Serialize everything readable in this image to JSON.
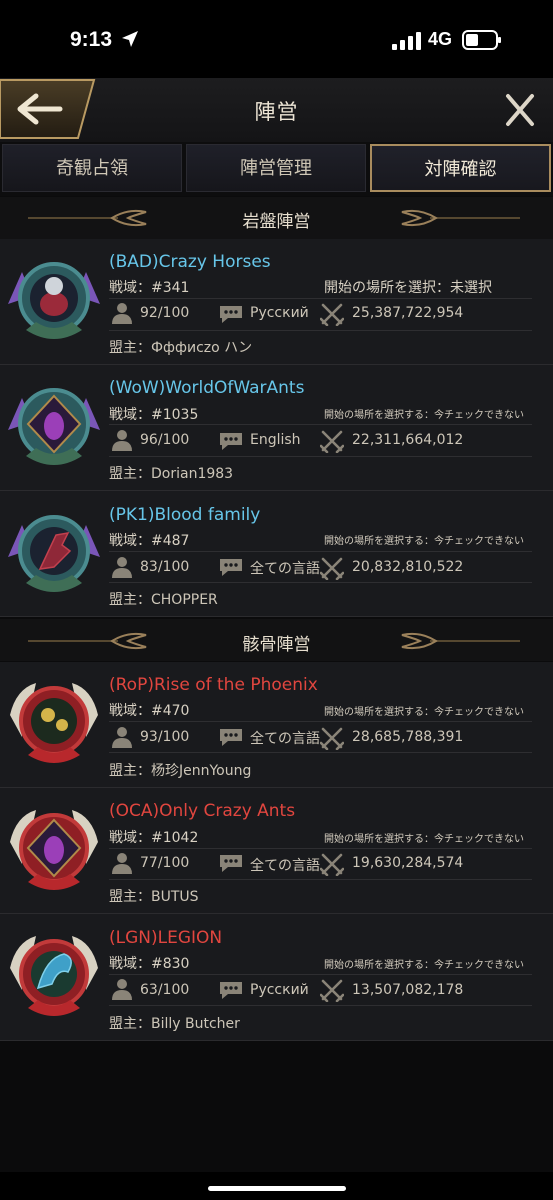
{
  "status": {
    "time": "9:13",
    "network": "4G"
  },
  "header": {
    "title": "陣営"
  },
  "tabs": [
    {
      "label": "奇観占領"
    },
    {
      "label": "陣営管理"
    },
    {
      "label": "対陣確認"
    }
  ],
  "sections": [
    {
      "title": "岩盤陣営",
      "alliances": [
        {
          "name": "(BAD)Crazy Horses",
          "zone": "戦域：#341",
          "start_label": "開始の場所を選択：未選択",
          "members": "92/100",
          "language": "Русский",
          "power": "25,387,722,954",
          "leader": "盟主：Ффф​исzо ハン"
        },
        {
          "name": "(WoW)WorldOfWarAnts",
          "zone": "戦域：#1035",
          "start_label": "開始の場所を選択する：今チェックできない",
          "members": "96/100",
          "language": "English",
          "power": "22,311,664,012",
          "leader": "盟主：Dorian1983"
        },
        {
          "name": "(PK1)Blood family",
          "zone": "戦域：#487",
          "start_label": "開始の場所を選択する：今チェックできない",
          "members": "83/100",
          "language": "全ての言語",
          "power": "20,832,810,522",
          "leader": "盟主：CHOPPER"
        }
      ]
    },
    {
      "title": "骸骨陣営",
      "alliances": [
        {
          "name": "(RoP)Rise of the Phoenix",
          "zone": "戦域：#470",
          "start_label": "開始の場所を選択する：今チェックできない",
          "members": "93/100",
          "language": "全ての言語",
          "power": "28,685,788,391",
          "leader": "盟主：杨珍JennYoung"
        },
        {
          "name": "(OCA)Only Crazy Ants",
          "zone": "戦域：#1042",
          "start_label": "開始の場所を選択する：今チェックできない",
          "members": "77/100",
          "language": "全ての言語",
          "power": "19,630,284,574",
          "leader": "盟主：BUTUS"
        },
        {
          "name": "(LGN)LEGION",
          "zone": "戦域：#830",
          "start_label": "開始の場所を選択する：今チェックできない",
          "members": "63/100",
          "language": "Русский",
          "power": "13,507,082,178",
          "leader": "盟主：Billy Butcher"
        }
      ]
    }
  ],
  "colors": {
    "blue_faction": "#67c6e9",
    "red_faction": "#e1463f",
    "gold_accent": "#a98c5e"
  }
}
